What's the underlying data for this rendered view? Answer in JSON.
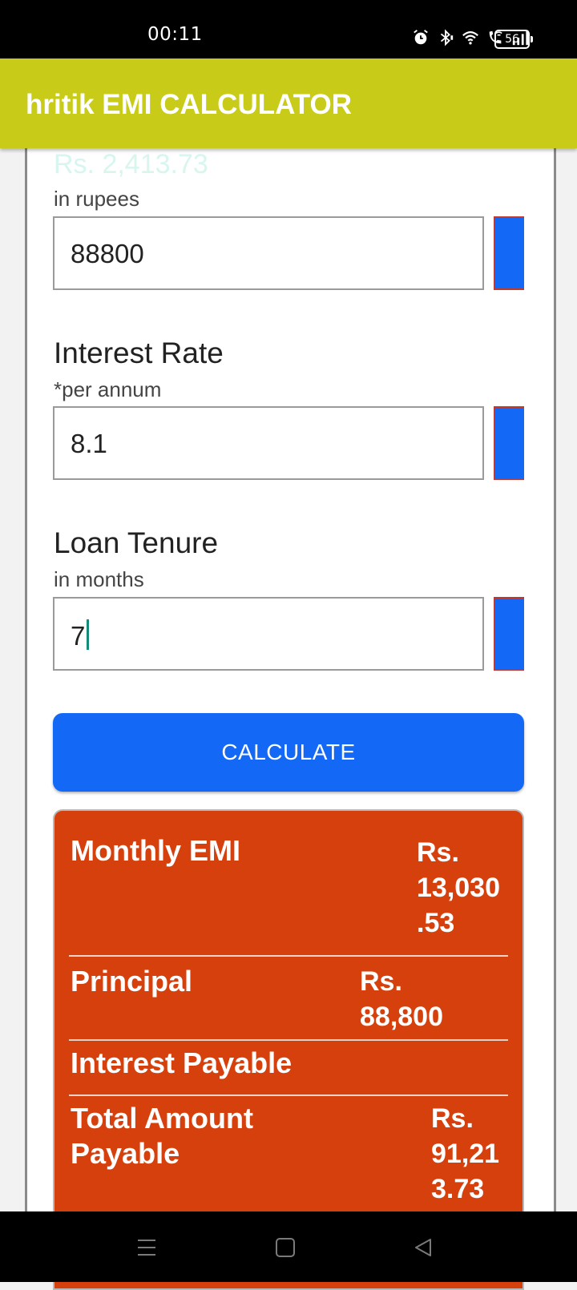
{
  "status_bar": {
    "time": "00:11",
    "battery": "56",
    "icons": [
      "alarm-icon",
      "bluetooth-icon",
      "wifi-icon",
      "wifi-call-icon",
      "signal-icon",
      "battery-icon"
    ]
  },
  "app_bar": {
    "title": "hritik EMI CALCULATOR",
    "color": "#c8cb18"
  },
  "form": {
    "ghost_emi": "Rs. 2,413.73",
    "amount": {
      "sub_label": "in rupees",
      "value": "88800"
    },
    "interest": {
      "label": "Interest Rate",
      "sub_label": "*per annum",
      "value": "8.1"
    },
    "tenure": {
      "label": "Loan Tenure",
      "sub_label": "in months",
      "value": "7"
    },
    "calculate_label": "CALCULATE",
    "accent": "#1369f5"
  },
  "result": {
    "color": "#d6400d",
    "monthly_emi": {
      "label": "Monthly EMI",
      "value_lines": [
        "Rs.",
        "13,030",
        ".53"
      ]
    },
    "principal": {
      "label": "Principal",
      "value_lines": [
        "Rs.",
        "88,800"
      ]
    },
    "interest_payable": {
      "label": "Interest Payable"
    },
    "total": {
      "label_lines": [
        "Total Amount",
        "Payable"
      ],
      "value_lines": [
        "Rs.",
        "91,21",
        "3.73"
      ]
    }
  },
  "nav_bar": {
    "icons": [
      "menu-icon",
      "home-icon",
      "back-icon"
    ]
  }
}
